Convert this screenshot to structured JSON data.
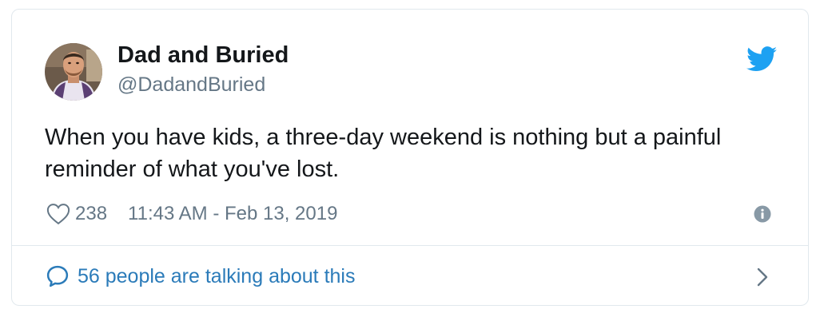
{
  "tweet": {
    "display_name": "Dad and Buried",
    "handle": "@DadandBuried",
    "text": "When you have kids, a three-day weekend is nothing but a painful reminder of what you've lost.",
    "like_count": "238",
    "timestamp": "11:43 AM - Feb 13, 2019"
  },
  "footer": {
    "conversation_text": "56 people are talking about this"
  },
  "icons": {
    "brand": "twitter-bird-icon",
    "like": "heart-icon",
    "info": "info-icon",
    "conversation": "speech-bubble-icon",
    "navigate": "chevron-right-icon"
  },
  "colors": {
    "brand_blue": "#1da1f2",
    "link_blue": "#2b7bb9",
    "text_primary": "#14171a",
    "text_secondary": "#657786",
    "border": "#e1e8ed"
  }
}
